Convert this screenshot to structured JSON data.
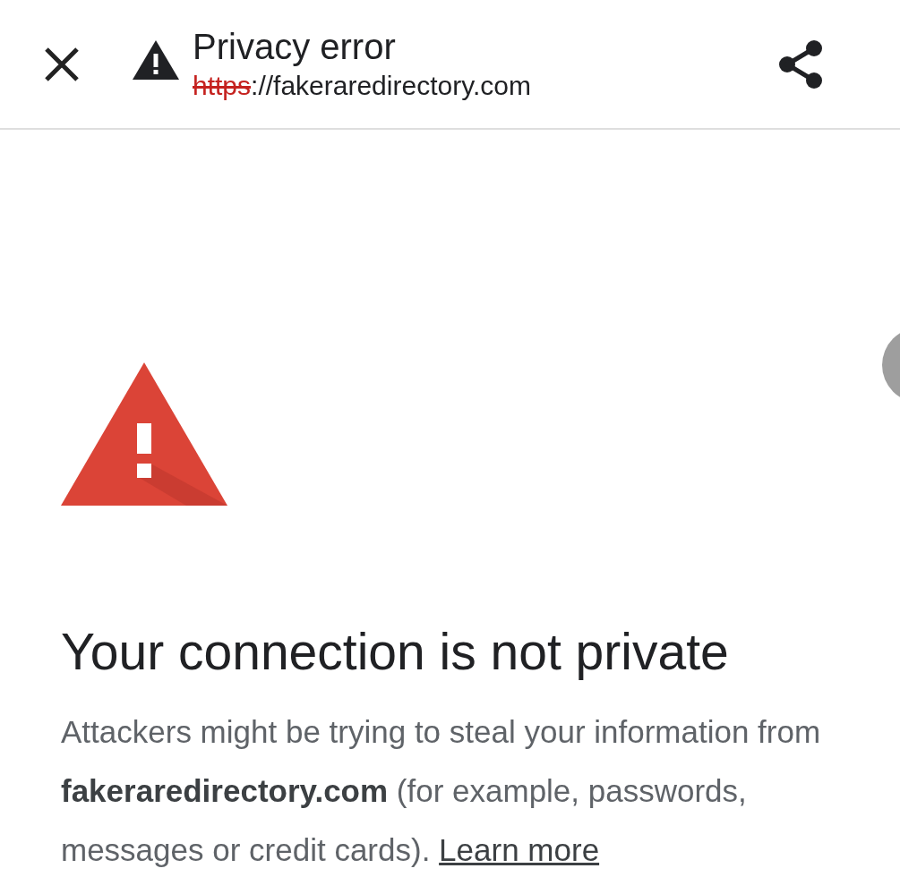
{
  "toolbar": {
    "title": "Privacy error",
    "url": {
      "scheme": "https",
      "scheme_insecure": true,
      "rest": "://fakeraredirectory.com"
    }
  },
  "page": {
    "heading": "Your connection is not private",
    "body": "Attackers might be trying to steal your information from **fakeraredirectory.com** (for example, passwords, messages or credit cards).",
    "link": "Learn more"
  }
}
